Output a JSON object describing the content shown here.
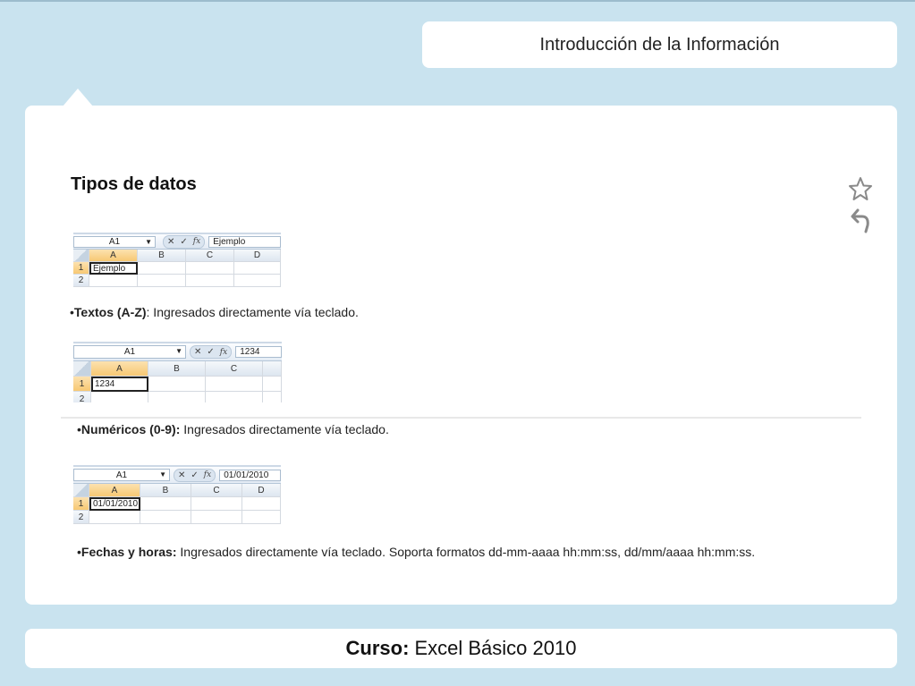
{
  "header": {
    "title": "Introducción de la Información"
  },
  "section": {
    "title": "Tipos de datos"
  },
  "bullets": [
    {
      "prefix": "•",
      "bold": "Textos (A-Z)",
      "text": ": Ingresados directamente vía teclado."
    },
    {
      "prefix": "•",
      "bold": "Numéricos (0-9):",
      "text": " Ingresados directamente vía teclado."
    },
    {
      "prefix": "•",
      "bold": "Fechas y horas:",
      "text": " Ingresados directamente vía teclado. Soporta formatos dd-mm-aaaa hh:mm:ss, dd/mm/aaaa hh:mm:ss."
    }
  ],
  "excel_snippets": [
    {
      "namebox": "A1",
      "formula": "Ejemplo",
      "columns": [
        "A",
        "B",
        "C",
        "D"
      ],
      "rows": [
        "1",
        "2"
      ],
      "cell_a1": "Ejemplo"
    },
    {
      "namebox": "A1",
      "formula": "1234",
      "columns": [
        "A",
        "B",
        "C"
      ],
      "rows": [
        "1",
        "2"
      ],
      "cell_a1": "1234"
    },
    {
      "namebox": "A1",
      "formula": "01/01/2010",
      "columns": [
        "A",
        "B",
        "C",
        "D"
      ],
      "rows": [
        "1",
        "2"
      ],
      "cell_a1": "01/01/2010"
    }
  ],
  "formula_buttons": {
    "cancel": "✕",
    "enter": "✓",
    "fx": "fx"
  },
  "footer": {
    "label": "Curso:",
    "course": "Excel Básico 2010"
  },
  "icons": {
    "favorite": "star-icon",
    "back": "back-arrow-icon"
  },
  "colors": {
    "background": "#c9e3ef",
    "card": "#ffffff",
    "selected_header": "#f7c873"
  }
}
